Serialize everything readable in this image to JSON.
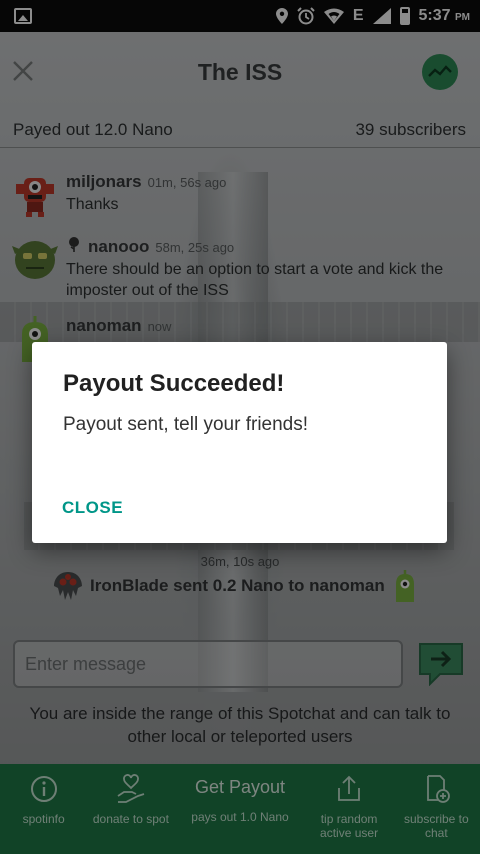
{
  "status_bar": {
    "time": "5:37",
    "ampm": "PM",
    "network": "E"
  },
  "header": {
    "title": "The ISS"
  },
  "info": {
    "payout": "Payed out 12.0 Nano",
    "subscribers": "39 subscribers"
  },
  "messages": [
    {
      "user": "miljonars",
      "stamp": "01m, 56s ago",
      "text": "Thanks"
    },
    {
      "user": "nanooo",
      "stamp": "58m, 25s ago",
      "text": "There should be an option to start a vote and kick the imposter out of the ISS"
    },
    {
      "user": "nanoman",
      "stamp": "now"
    }
  ],
  "tip": {
    "stamp": "36m, 10s ago",
    "text": "IronBlade sent 0.2 Nano to nanoman"
  },
  "composer": {
    "placeholder": "Enter message"
  },
  "range_notice": "You are inside the range of this Spotchat and can talk to other local or teleported users",
  "bottom_bar": {
    "spotinfo": "spotinfo",
    "donate": "donate to spot",
    "payout_title": "Get Payout",
    "payout_sub": "pays out 1.0 Nano",
    "tip": "tip random active user",
    "subscribe": "subscribe to chat"
  },
  "dialog": {
    "title": "Payout Succeeded!",
    "message": "Payout sent, tell your friends!",
    "close": "CLOSE"
  },
  "colors": {
    "accent": "#009688",
    "bar_green": "#1f7a48"
  },
  "icons": [
    "image-icon",
    "location-pin-icon",
    "alarm-icon",
    "wifi-icon",
    "signal-icon",
    "battery-icon",
    "close-icon",
    "trend-icon",
    "send-icon",
    "info-icon",
    "donate-icon",
    "share-icon",
    "subscribe-icon"
  ]
}
